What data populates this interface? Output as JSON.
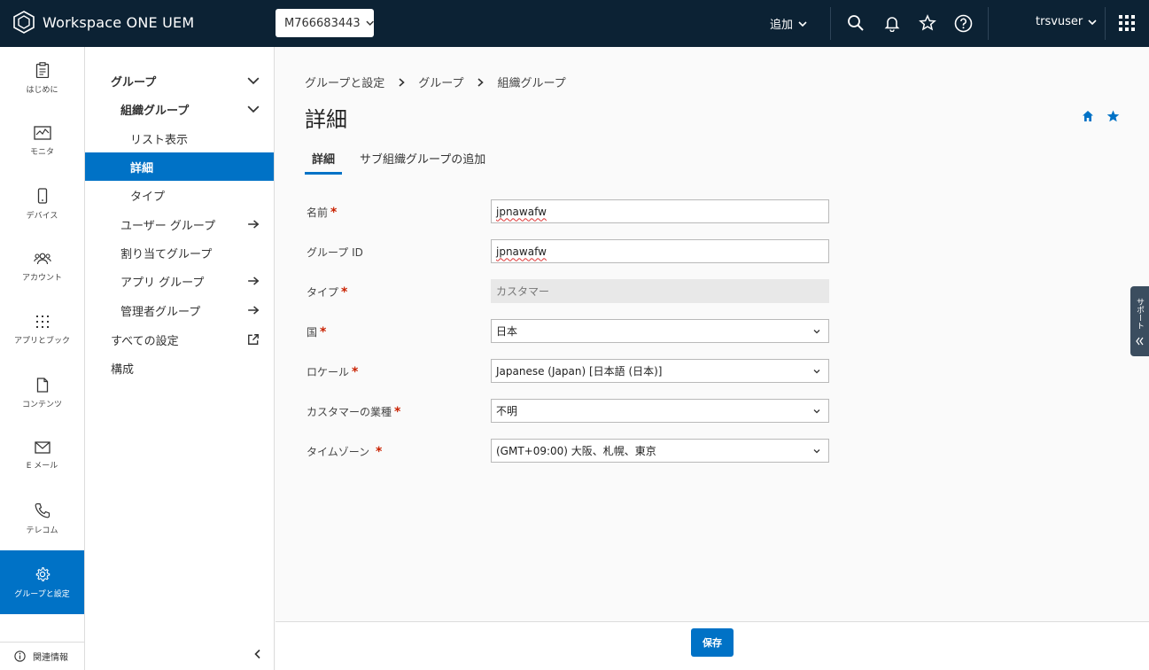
{
  "header": {
    "app_name": "Workspace ONE UEM",
    "org_group_id": "M766683443",
    "add_label": "追加",
    "username": "trsvuser"
  },
  "rail": {
    "items": [
      {
        "label": "はじめに",
        "icon": "clipboard-icon"
      },
      {
        "label": "モニタ",
        "icon": "monitor-icon"
      },
      {
        "label": "デバイス",
        "icon": "phone-icon"
      },
      {
        "label": "アカウント",
        "icon": "users-icon"
      },
      {
        "label": "アプリとブック",
        "icon": "grid-dots-icon"
      },
      {
        "label": "コンテンツ",
        "icon": "document-icon"
      },
      {
        "label": "E メール",
        "icon": "envelope-icon"
      },
      {
        "label": "テレコム",
        "icon": "phone-call-icon"
      },
      {
        "label": "グループと設定",
        "icon": "gear-icon"
      }
    ],
    "related_info": "関連情報"
  },
  "subnav": {
    "groups": "グループ",
    "org_groups": "組織グループ",
    "list_view": "リスト表示",
    "details": "詳細",
    "type": "タイプ",
    "user_groups": "ユーザー グループ",
    "assignment_groups": "割り当てグループ",
    "app_groups": "アプリ グループ",
    "admin_groups": "管理者グループ",
    "all_settings": "すべての設定",
    "configuration": "構成"
  },
  "breadcrumb": [
    "グループと設定",
    "グループ",
    "組織グループ"
  ],
  "page_title": "詳細",
  "tabs": [
    "詳細",
    "サブ組織グループの追加"
  ],
  "form": {
    "name_label": "名前",
    "name_value": "jpnawafw",
    "group_id_label": "グループ ID",
    "group_id_value": "jpnawafw",
    "type_label": "タイプ",
    "type_value": "カスタマー",
    "country_label": "国",
    "country_value": "日本",
    "locale_label": "ロケール",
    "locale_value": "Japanese (Japan) [日本語 (日本)]",
    "industry_label": "カスタマーの業種",
    "industry_value": "不明",
    "timezone_label": "タイムゾーン",
    "timezone_value": "(GMT+09:00) 大阪、札幌、東京",
    "required_mark": "*"
  },
  "support_label": "サポート",
  "footer": {
    "save_label": "保存"
  },
  "colors": {
    "header_bg": "#0c2234",
    "accent": "#0072c6",
    "required": "#c92100"
  }
}
